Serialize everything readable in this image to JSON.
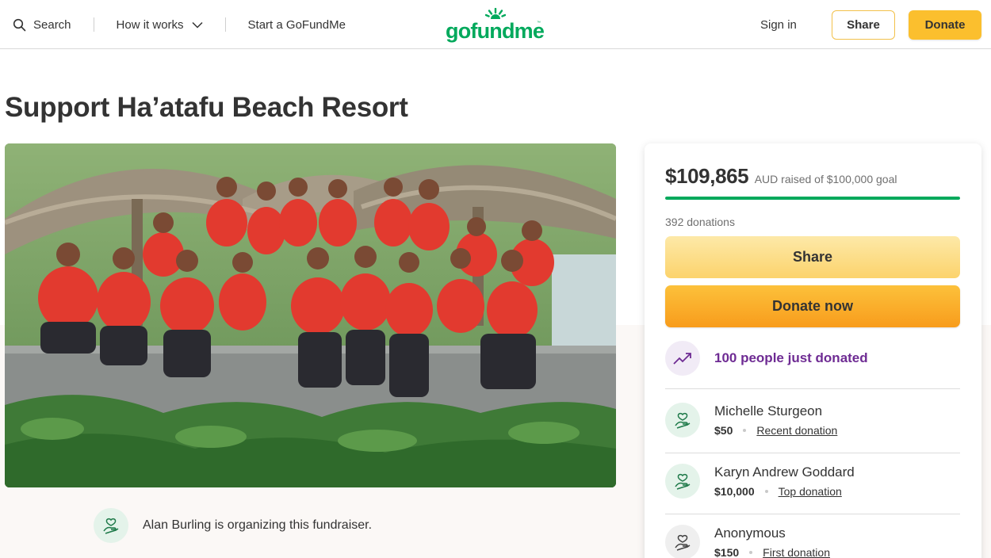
{
  "header": {
    "search_label": "Search",
    "how_it_works_label": "How it works",
    "start_label": "Start a GoFundMe",
    "logo_text": "gofundme",
    "logo_tm": "™",
    "signin_label": "Sign in",
    "share_label": "Share",
    "donate_label": "Donate"
  },
  "campaign": {
    "title": "Support Ha’atafu Beach Resort",
    "organizer_text": "Alan Burling is organizing this fundraiser."
  },
  "sidebar": {
    "amount_raised": "$109,865",
    "raised_suffix": "AUD raised of $100,000 goal",
    "progress_fraction": 1.0,
    "donation_count": "392 donations",
    "share_label": "Share",
    "donate_now_label": "Donate now",
    "trending_text": "100 people just donated",
    "donors": [
      {
        "name": "Michelle Sturgeon",
        "amount": "$50",
        "tag": "Recent donation"
      },
      {
        "name": "Karyn Andrew Goddard",
        "amount": "$10,000",
        "tag": "Top donation"
      },
      {
        "name": "Anonymous",
        "amount": "$150",
        "tag": "First donation"
      }
    ]
  },
  "colors": {
    "brand_green": "#02a95c",
    "donate_yellow": "#fbbf2e",
    "trend_purple": "#6e2b93"
  },
  "icons": [
    "search-icon",
    "chevron-down-icon",
    "logo-sun-icon",
    "heart-hand-icon",
    "trending-up-icon"
  ]
}
